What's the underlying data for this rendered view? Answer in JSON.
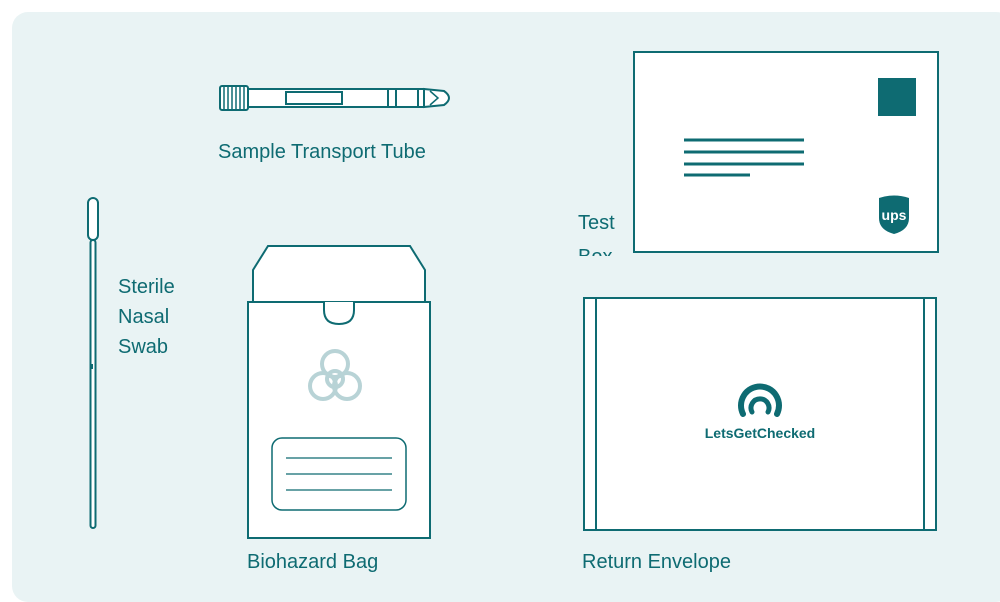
{
  "colors": {
    "background": "#e9f3f4",
    "teal": "#0e6b72",
    "line": "#0e6b72",
    "biohazard": "#b8d3d6",
    "white": "#ffffff"
  },
  "items": {
    "tube": {
      "label": "Sample Transport Tube",
      "icon": "tube-icon"
    },
    "swab": {
      "label_lines": [
        "Sterile",
        "Nasal",
        "Swab"
      ],
      "icon": "swab-icon"
    },
    "bag": {
      "label": "Biohazard Bag",
      "icon": "biohazard-icon"
    },
    "box": {
      "label_lines": [
        "Test",
        "Box"
      ],
      "icon": "ups-icon"
    },
    "envelope": {
      "label": "Return Envelope",
      "brand": "LetsGetChecked",
      "icon": "letsgetchecked-logo-icon"
    },
    "ups": {
      "logo_text": "ups"
    }
  }
}
